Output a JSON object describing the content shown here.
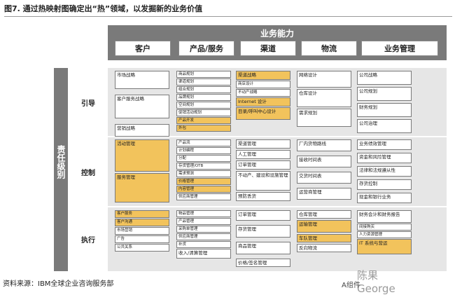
{
  "title": "图7. 通过热映射图确定出“热”领域，以发掘新的业务价值",
  "source": "资料来源：IBM全球企业咨询服务部",
  "capabilities": {
    "title": "业务能力",
    "columns": [
      "客户",
      "产品/服务",
      "渠道",
      "物流",
      "业务管理"
    ]
  },
  "responsibility": {
    "title": "责任级别",
    "rows": [
      "引导",
      "控制",
      "执行"
    ]
  },
  "watermark": {
    "line1": "陈果George",
    "line2": "A组件"
  },
  "colors": {
    "highlight": "#f2c35c",
    "header_bar": "#7a7a7a",
    "grid_bg": "#e6e6e6"
  },
  "cells": {
    "guide": {
      "customer": [
        {
          "text": "市场战略",
          "hot": false
        },
        {
          "text": "客户服务战略",
          "hot": false
        },
        {
          "text": "营销战略",
          "hot": false
        }
      ],
      "product": [
        {
          "text": "商品规划",
          "hot": false
        },
        {
          "text": "渠道规划",
          "hot": false
        },
        {
          "text": "组合规划",
          "hot": false
        },
        {
          "text": "品牌规划",
          "hot": false
        },
        {
          "text": "空间规划",
          "hot": false
        },
        {
          "text": "促销活动规划",
          "hot": false
        },
        {
          "text": "产品开发",
          "hot": true
        },
        {
          "text": "外包",
          "hot": true
        }
      ],
      "channel": [
        {
          "text": "渠道战略",
          "hot": true
        },
        {
          "text": "商店设计",
          "hot": false
        },
        {
          "text": "不动产战略",
          "hot": false
        },
        {
          "text": "Internet 设计",
          "hot": true
        },
        {
          "text": "目录/呼叫中心设计",
          "hot": true
        }
      ],
      "logistics": [
        {
          "text": "网络设计",
          "hot": false
        },
        {
          "text": "仓库设计",
          "hot": false
        },
        {
          "text": "需求规划",
          "hot": false
        }
      ],
      "management": [
        {
          "text": "公司战略",
          "hot": false
        },
        {
          "text": "公司规划",
          "hot": false
        },
        {
          "text": "财务规划",
          "hot": false
        },
        {
          "text": "公司治理",
          "hot": false
        }
      ]
    },
    "control": {
      "customer": [
        {
          "text": "活动管理",
          "hot": true
        },
        {
          "text": "服务管理",
          "hot": true
        }
      ],
      "product": [
        {
          "text": "产品流",
          "hot": false
        },
        {
          "text": "计划编程",
          "hot": false
        },
        {
          "text": "分配",
          "hot": false
        },
        {
          "text": "存货管理/OTB",
          "hot": false
        },
        {
          "text": "需求预测",
          "hot": false
        },
        {
          "text": "价格管理",
          "hot": true
        },
        {
          "text": "内容管理",
          "hot": true
        },
        {
          "text": "供应商管理",
          "hot": false
        }
      ],
      "channel": [
        {
          "text": "渠道管理",
          "hot": false
        },
        {
          "text": "人工管理",
          "hot": false
        },
        {
          "text": "订单管理",
          "hot": false
        },
        {
          "text": "不动产、建设和设施管理",
          "hot": false
        },
        {
          "text": "预防丢货",
          "hot": false
        }
      ],
      "logistics": [
        {
          "text": "厂内货物路线",
          "hot": false
        },
        {
          "text": "接收时间表",
          "hot": false
        },
        {
          "text": "交货时间表",
          "hot": false
        },
        {
          "text": "运营商管理",
          "hot": false
        }
      ],
      "management": [
        {
          "text": "业务绩效管理",
          "hot": false
        },
        {
          "text": "资金和风险管理",
          "hot": false
        },
        {
          "text": "法律和法规遵从性",
          "hot": false
        },
        {
          "text": "存货控制",
          "hot": false
        },
        {
          "text": "现金和银行业务",
          "hot": false
        }
      ]
    },
    "execute": {
      "customer": [
        {
          "text": "客户服务",
          "hot": true
        },
        {
          "text": "客户沟通",
          "hot": true
        },
        {
          "text": "市场营销",
          "hot": false
        },
        {
          "text": "广告",
          "hot": false
        },
        {
          "text": "公共关系",
          "hot": false
        }
      ],
      "product": [
        {
          "text": "物品管理",
          "hot": false
        },
        {
          "text": "产品管理",
          "hot": false
        },
        {
          "text": "采购单管理",
          "hot": false
        },
        {
          "text": "供应商管理",
          "hot": false
        },
        {
          "text": "补货",
          "hot": false
        },
        {
          "text": "收入/清算管理",
          "hot": false
        }
      ],
      "channel": [
        {
          "text": "订单管理",
          "hot": false
        },
        {
          "text": "存货管理",
          "hot": false
        },
        {
          "text": "商品管理",
          "hot": false
        },
        {
          "text": "价格/签名管理",
          "hot": false
        }
      ],
      "logistics": [
        {
          "text": "仓库管理",
          "hot": false
        },
        {
          "text": "运输管理",
          "hot": true
        },
        {
          "text": "车队管理",
          "hot": true
        },
        {
          "text": "反向物流",
          "hot": false
        }
      ],
      "management": [
        {
          "text": "财务会计和财务报告",
          "hot": false
        },
        {
          "text": "间接购买",
          "hot": false
        },
        {
          "text": "人力资源管理",
          "hot": false
        },
        {
          "text": "IT 系统与营运",
          "hot": true
        }
      ]
    }
  }
}
